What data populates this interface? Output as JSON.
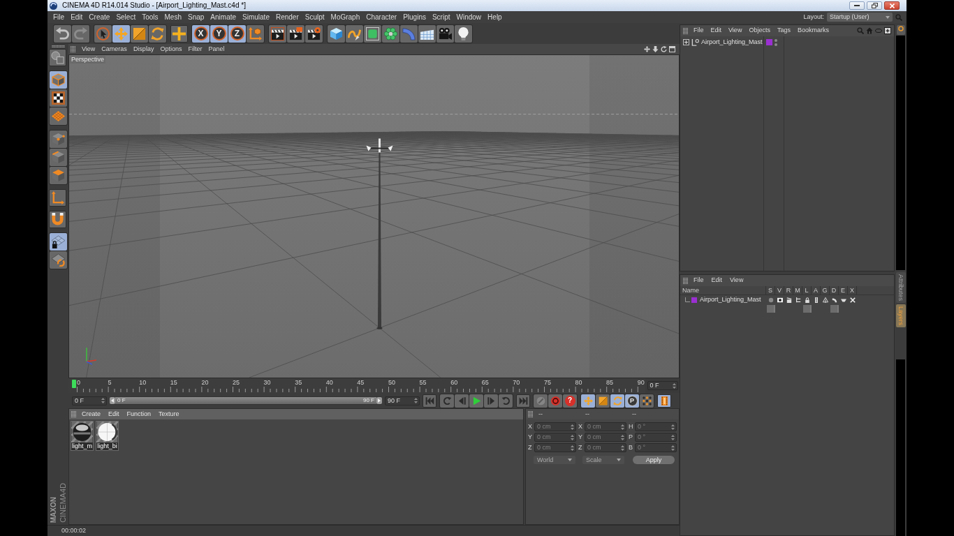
{
  "window": {
    "title": "CINEMA 4D R14.014 Studio - [Airport_Lighting_Mast.c4d *]"
  },
  "menu": [
    "File",
    "Edit",
    "Create",
    "Select",
    "Tools",
    "Mesh",
    "Snap",
    "Animate",
    "Simulate",
    "Render",
    "Sculpt",
    "MoGraph",
    "Character",
    "Plugins",
    "Script",
    "Window",
    "Help"
  ],
  "layout": {
    "label": "Layout:",
    "value": "Startup (User)"
  },
  "toolbar": [
    [
      {
        "kind": "undo",
        "selected": false,
        "disabled": false
      },
      {
        "kind": "redo",
        "selected": false,
        "disabled": true
      }
    ],
    [
      {
        "kind": "select",
        "selected": false
      },
      {
        "kind": "move",
        "selected": true
      },
      {
        "kind": "scale",
        "selected": false
      },
      {
        "kind": "rotate",
        "selected": false
      }
    ],
    [
      {
        "kind": "add",
        "selected": false
      }
    ],
    [
      {
        "kind": "axis",
        "label": "X",
        "selected": true
      },
      {
        "kind": "axis",
        "label": "Y",
        "selected": true
      },
      {
        "kind": "axis",
        "label": "Z",
        "selected": true
      },
      {
        "kind": "coords",
        "selected": false
      }
    ],
    [
      {
        "kind": "renderview",
        "selected": false
      },
      {
        "kind": "render",
        "selected": false
      },
      {
        "kind": "rendersettings",
        "selected": false
      }
    ],
    [
      {
        "kind": "cube",
        "selected": false
      },
      {
        "kind": "pen",
        "selected": false
      },
      {
        "kind": "subdivide",
        "selected": false
      },
      {
        "kind": "cloner",
        "selected": false
      },
      {
        "kind": "deformer",
        "selected": false
      },
      {
        "kind": "floor",
        "selected": false
      },
      {
        "kind": "camera",
        "selected": false
      },
      {
        "kind": "light",
        "selected": false
      }
    ]
  ],
  "object_manager": {
    "menu": [
      "File",
      "Edit",
      "View",
      "Objects",
      "Tags",
      "Bookmarks"
    ],
    "objects": [
      {
        "name": "Airport_Lighting_Mast",
        "color": "#9b30d2",
        "expanded": false
      }
    ]
  },
  "palette": [
    [
      {
        "kind": "editable",
        "selected": false
      }
    ],
    [
      {
        "kind": "model",
        "selected": true
      },
      {
        "kind": "texture",
        "selected": false
      },
      {
        "kind": "workplane",
        "selected": false
      }
    ],
    [
      {
        "kind": "points",
        "selected": false
      },
      {
        "kind": "edges",
        "selected": false
      },
      {
        "kind": "polygons",
        "selected": false
      }
    ],
    [
      {
        "kind": "axismode",
        "selected": false
      }
    ],
    [
      {
        "kind": "snap",
        "selected": false
      }
    ],
    [
      {
        "kind": "lock",
        "selected": true
      },
      {
        "kind": "align",
        "selected": false
      }
    ]
  ],
  "logo": {
    "brand": "MAXON",
    "product": "CINEMA4D"
  },
  "viewport": {
    "menu": [
      "View",
      "Cameras",
      "Display",
      "Options",
      "Filter",
      "Panel"
    ],
    "camera": "Perspective"
  },
  "timeline": {
    "ticks": [
      "0",
      "5",
      "10",
      "15",
      "20",
      "25",
      "30",
      "35",
      "40",
      "45",
      "50",
      "55",
      "60",
      "65",
      "70",
      "75",
      "80",
      "85",
      "90"
    ],
    "playhead": {
      "level": 0
    },
    "frame": "0 F"
  },
  "transport": {
    "start": "0 F",
    "range": {
      "start": {
        "label": "0 F",
        "level": 0
      },
      "end": {
        "label": "90 F",
        "level": 1
      }
    },
    "end": "90 F",
    "buttons": [
      [
        {
          "kind": "first",
          "selected": false
        }
      ],
      [
        {
          "kind": "prevkey",
          "selected": false
        },
        {
          "kind": "prevframe",
          "selected": false
        },
        {
          "kind": "play",
          "selected": false
        },
        {
          "kind": "nextframe",
          "selected": false
        },
        {
          "kind": "nextkey",
          "selected": false
        }
      ],
      [
        {
          "kind": "last",
          "selected": false
        }
      ],
      [
        {
          "kind": "record",
          "selected": false
        },
        {
          "kind": "autokey",
          "selected": false
        },
        {
          "kind": "keysel",
          "label": "?",
          "selected": false
        }
      ],
      [
        {
          "kind": "position",
          "selected": true
        },
        {
          "kind": "size",
          "selected": false
        },
        {
          "kind": "rotation",
          "selected": true
        },
        {
          "kind": "param",
          "label": "P",
          "selected": true
        },
        {
          "kind": "pla",
          "selected": false
        }
      ],
      [
        {
          "kind": "timeline",
          "selected": true
        }
      ]
    ]
  },
  "materials": {
    "menu": [
      "Create",
      "Edit",
      "Function",
      "Texture"
    ],
    "items": [
      {
        "kind": "chrome",
        "name": "light_m"
      },
      {
        "kind": "matte",
        "name": "light_bi"
      }
    ]
  },
  "coordinates": {
    "headers": [
      "--",
      "--",
      "--"
    ],
    "rows": [
      {
        "axis": "X",
        "position": "0 cm",
        "size_axis": "X",
        "size": "0 cm",
        "rotation_axis": "H",
        "rotation": "0 °"
      },
      {
        "axis": "Y",
        "position": "0 cm",
        "size_axis": "Y",
        "size": "0 cm",
        "rotation_axis": "P",
        "rotation": "0 °"
      },
      {
        "axis": "Z",
        "position": "0 cm",
        "size_axis": "Z",
        "size": "0 cm",
        "rotation_axis": "B",
        "rotation": "0 °"
      }
    ],
    "position_mode": "World",
    "size_mode": "Scale",
    "apply": "Apply",
    "disabled": true
  },
  "status_bar": {
    "time": "00:00:02"
  },
  "layer_manager": {
    "menu": [
      "File",
      "Edit",
      "View"
    ],
    "columns": [
      "Name",
      "S",
      "V",
      "R",
      "M",
      "L",
      "A",
      "G",
      "D",
      "E",
      "X"
    ],
    "layers": [
      {
        "name": "Airport_Lighting_Mast",
        "color": "#9b30d2"
      }
    ]
  },
  "side_tabs": [
    {
      "label": "Attributes",
      "selected": false
    },
    {
      "label": "Layers",
      "selected": true
    }
  ]
}
